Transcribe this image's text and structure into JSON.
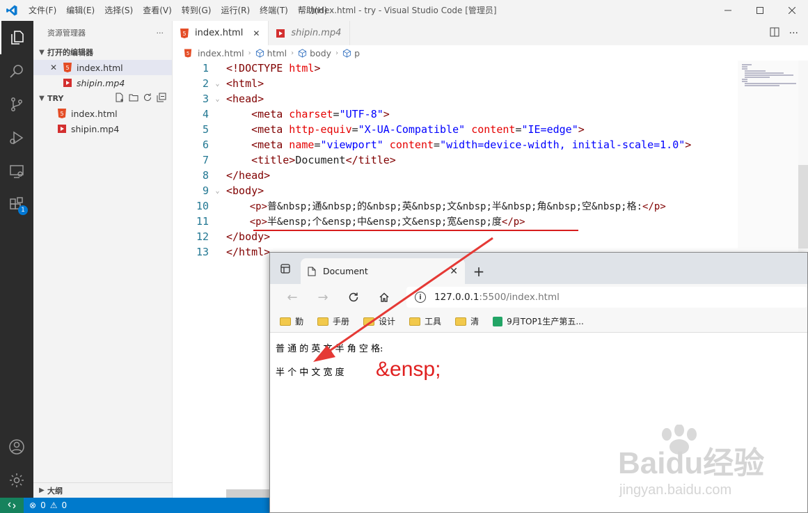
{
  "window": {
    "title": "index.html - try - Visual Studio Code [管理员]",
    "menu": [
      "文件(F)",
      "编辑(E)",
      "选择(S)",
      "查看(V)",
      "转到(G)",
      "运行(R)",
      "终端(T)",
      "帮助(H)"
    ]
  },
  "activity": {
    "extensions_badge": "1"
  },
  "sidebar": {
    "title": "资源管理器",
    "more": "···",
    "open_editors_label": "打开的编辑器",
    "open_editors": [
      {
        "name": "index.html",
        "close": "✕"
      },
      {
        "name": "shipin.mp4"
      }
    ],
    "folder_label": "TRY",
    "files": [
      {
        "name": "index.html"
      },
      {
        "name": "shipin.mp4"
      }
    ],
    "outline_label": "大纲"
  },
  "tabs": [
    {
      "label": "index.html",
      "close": "✕"
    },
    {
      "label": "shipin.mp4"
    }
  ],
  "breadcrumb": [
    "index.html",
    "html",
    "body",
    "p"
  ],
  "editor": {
    "line_numbers": [
      "1",
      "2",
      "3",
      "4",
      "5",
      "6",
      "7",
      "8",
      "9",
      "10",
      "11",
      "12",
      "13"
    ],
    "lines": {
      "l1": {
        "t1": "<!DOCTYPE",
        "t2": " html",
        "t3": ">"
      },
      "l2": "<html>",
      "l3": "<head>",
      "l4": {
        "tag": "<meta",
        "attr": " charset",
        "eq": "=",
        "val": "\"UTF-8\"",
        "end": ">"
      },
      "l5": {
        "tag": "<meta",
        "attr1": " http-equiv",
        "eq1": "=",
        "val1": "\"X-UA-Compatible\"",
        "attr2": " content",
        "eq2": "=",
        "val2": "\"IE=edge\"",
        "end": ">"
      },
      "l6": {
        "tag": "<meta",
        "attr1": " name",
        "eq1": "=",
        "val1": "\"viewport\"",
        "attr2": " content",
        "eq2": "=",
        "val2": "\"width=device-width, initial-scale=1.0\"",
        "end": ">"
      },
      "l7": {
        "open": "<title>",
        "text": "Document",
        "close": "</title>"
      },
      "l8": "</head>",
      "l9": "<body>",
      "l10": {
        "open": "<p>",
        "text": "普&nbsp;通&nbsp;的&nbsp;英&nbsp;文&nbsp;半&nbsp;角&nbsp;空&nbsp;格:",
        "close": "</p>"
      },
      "l11": {
        "open": "<p>",
        "text": "半&ensp;个&ensp;中&ensp;文&ensp;宽&ensp;度",
        "close": "</p>"
      },
      "l12": "</body>",
      "l13": "</html>"
    }
  },
  "statusbar": {
    "errors": "0",
    "warnings": "0"
  },
  "browser": {
    "tab_title": "Document",
    "tab_close": "✕",
    "new_tab": "+",
    "url_host": "127.0.0.1",
    "url_path": ":5500/index.html",
    "bookmarks": [
      "勤",
      "手册",
      "设计",
      "工具",
      "清",
      "9月TOP1生产第五..."
    ],
    "content": {
      "line1": "普 通 的 英 文 半 角 空 格:",
      "line2": "半 个 中 文 宽 度",
      "annotation": "&ensp;"
    }
  },
  "watermark": {
    "brand": "Baidu经验",
    "url": "jingyan.baidu.com"
  },
  "colors": {
    "accent": "#007acc",
    "annotation_red": "#e02020",
    "tag": "#800000",
    "attr": "#e50000",
    "value": "#0000ff"
  }
}
